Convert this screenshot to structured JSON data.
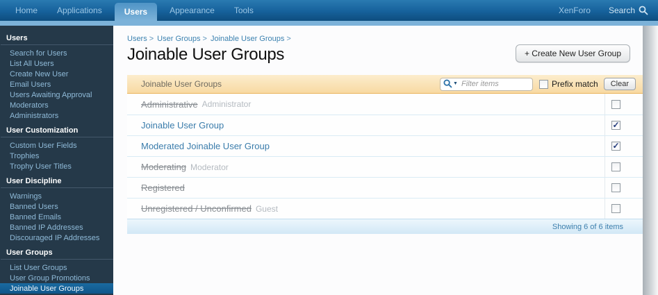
{
  "nav": {
    "items": [
      {
        "label": "Home",
        "active": false
      },
      {
        "label": "Applications",
        "active": false
      },
      {
        "label": "Users",
        "active": true
      },
      {
        "label": "Appearance",
        "active": false
      },
      {
        "label": "Tools",
        "active": false
      }
    ],
    "brand": "XenForo",
    "search_label": "Search"
  },
  "sidebar": {
    "sections": [
      {
        "title": "Users",
        "items": [
          "Search for Users",
          "List All Users",
          "Create New User",
          "Email Users",
          "Users Awaiting Approval",
          "Moderators",
          "Administrators"
        ]
      },
      {
        "title": "User Customization",
        "items": [
          "Custom User Fields",
          "Trophies",
          "Trophy User Titles"
        ]
      },
      {
        "title": "User Discipline",
        "items": [
          "Warnings",
          "Banned Users",
          "Banned Emails",
          "Banned IP Addresses",
          "Discouraged IP Addresses"
        ]
      },
      {
        "title": "User Groups",
        "items": [
          "List User Groups",
          "User Group Promotions",
          "Joinable User Groups"
        ]
      }
    ],
    "selected_item": "Joinable User Groups"
  },
  "breadcrumb": {
    "items": [
      "Users",
      "User Groups",
      "Joinable User Groups"
    ],
    "separator": ">"
  },
  "page": {
    "title": "Joinable User Groups",
    "create_button": "+ Create New User Group"
  },
  "panel": {
    "header": "Joinable User Groups",
    "filter_placeholder": "Filter items",
    "prefix_match_label": "Prefix match",
    "prefix_match_checked": false,
    "clear_button": "Clear",
    "rows": [
      {
        "name": "Administrative",
        "style": "struck",
        "secondary": "Administrator",
        "checked": false
      },
      {
        "name": "Joinable User Group",
        "style": "link",
        "secondary": "",
        "checked": true
      },
      {
        "name": "Moderated Joinable User Group",
        "style": "link",
        "secondary": "",
        "checked": true
      },
      {
        "name": "Moderating",
        "style": "struck",
        "secondary": "Moderator",
        "checked": false
      },
      {
        "name": "Registered",
        "style": "struck",
        "secondary": "",
        "checked": false
      },
      {
        "name": "Unregistered / Unconfirmed",
        "style": "struck",
        "secondary": "Guest",
        "checked": false
      }
    ],
    "footer": "Showing 6 of 6 items"
  },
  "icons": {
    "nav_search": "magnifier-icon",
    "filter": "magnifier-dropdown-icon",
    "check_mark": "✓"
  },
  "colors": {
    "nav_gradient_top": "#2a7ab1",
    "nav_gradient_bottom": "#0e4d7e",
    "active_tab": "#7cb2d9",
    "sidebar_bg": "#253949",
    "sidebar_selected_bg": "#13598a",
    "panel_header_orange": "#f8d9a2",
    "link_blue": "#3a7cab",
    "row_separator": "#d9ebf5",
    "footer_bg": "#d2e8f6",
    "footer_text": "#3d7fad",
    "check_color": "#223a7a"
  }
}
